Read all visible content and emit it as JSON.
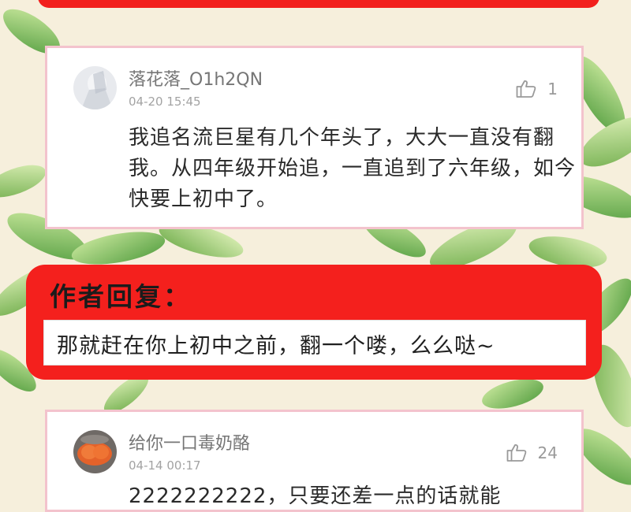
{
  "comments": [
    {
      "username": "落花落_O1h2QN",
      "time": "04-20 15:45",
      "likes": "1",
      "text": "我追名流巨星有几个年头了，大大一直没有翻我。从四年级开始追，一直追到了六年级，如今快要上初中了。",
      "avatar_icon": "avatar-image"
    },
    {
      "username": "给你一口毒奶酪",
      "time": "04-14 00:17",
      "likes": "24",
      "text": "2222222222，只要还差一点的话就能",
      "avatar_icon": "avatar-image"
    }
  ],
  "author_reply": {
    "title": "作者回复：",
    "text": "那就赶在你上初中之前，翻一个喽，么么哒~"
  },
  "colors": {
    "accent_red": "#f2201d",
    "card_border": "#f3c3cd",
    "background": "#f6efdc"
  },
  "icons": {
    "like": "thumbs-up-icon"
  }
}
